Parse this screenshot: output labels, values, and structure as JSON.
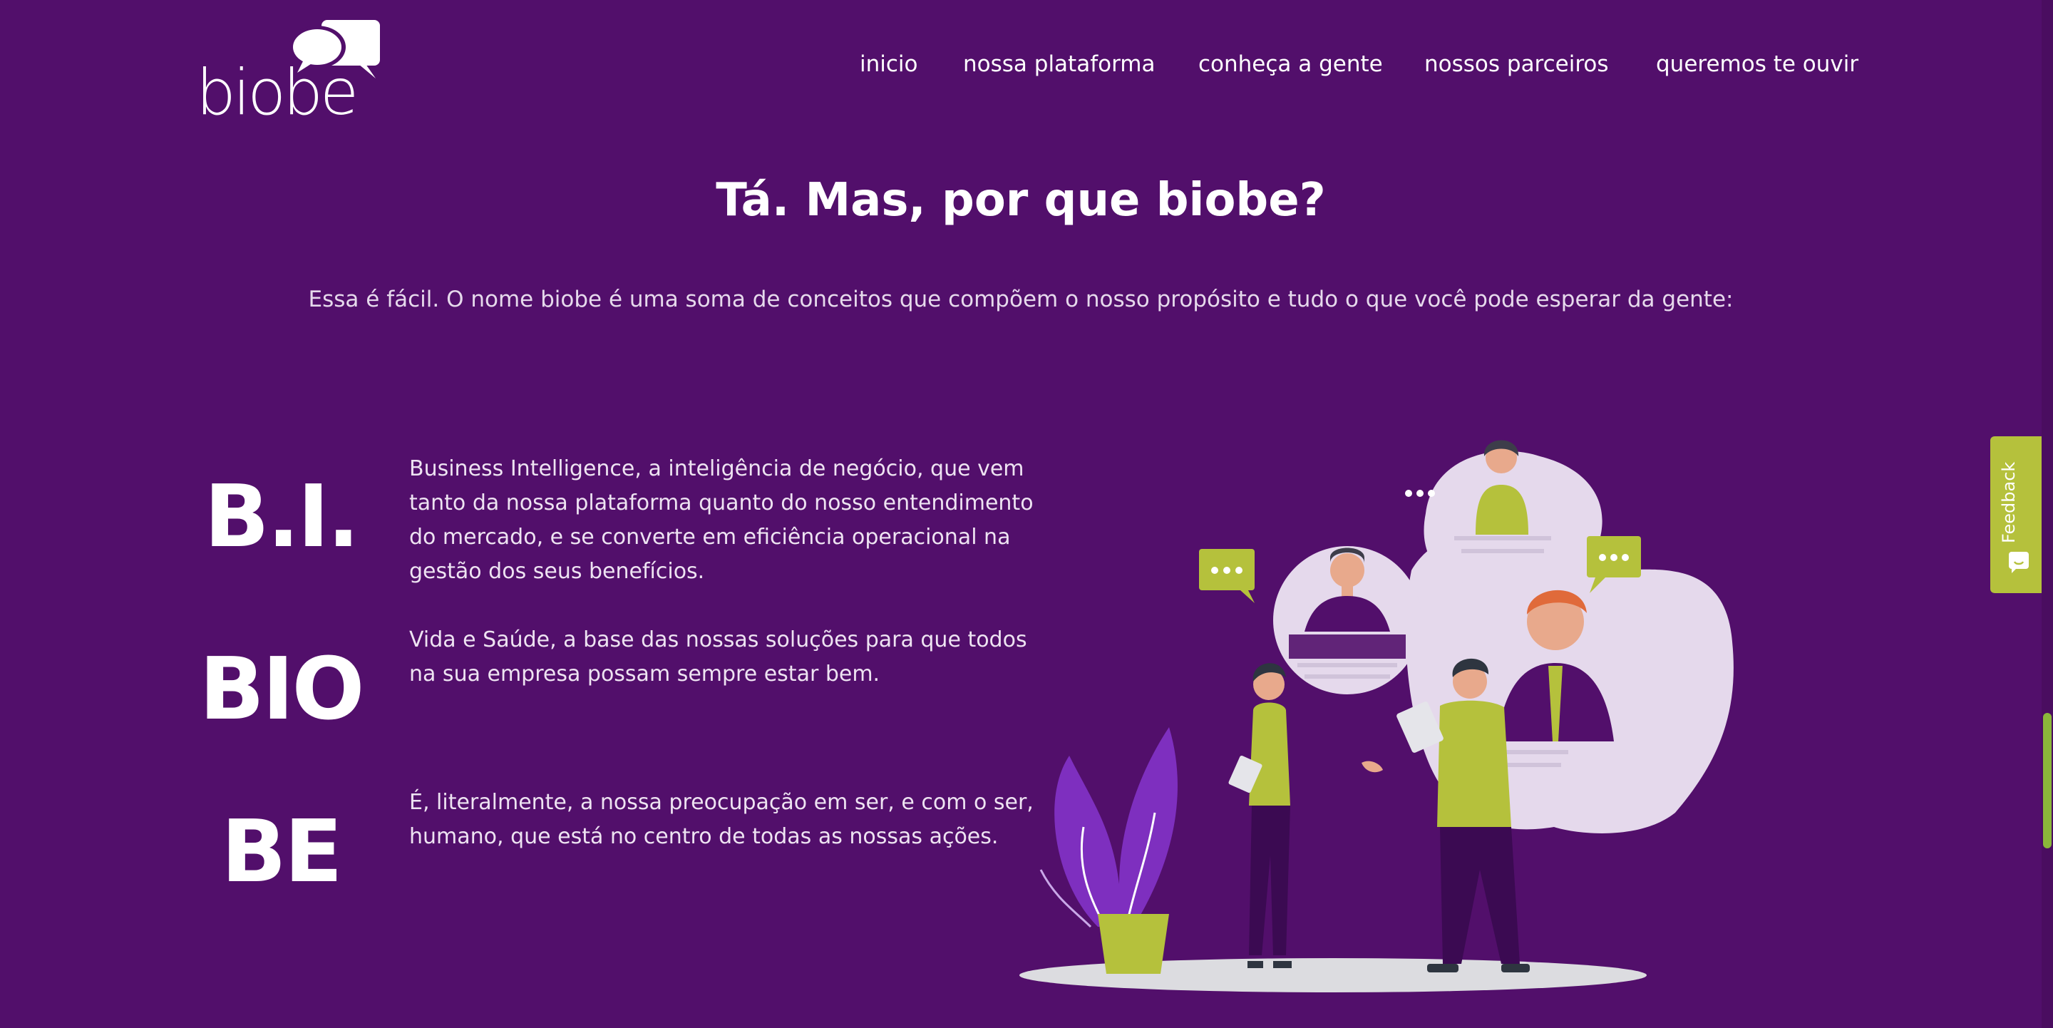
{
  "brand": {
    "logo_text": "biobe"
  },
  "nav": {
    "items": [
      {
        "label": "inicio"
      },
      {
        "label": "nossa plataforma"
      },
      {
        "label": "conheça a gente"
      },
      {
        "label": "nossos parceiros"
      },
      {
        "label": "queremos te ouvir"
      }
    ]
  },
  "section": {
    "title": "Tá. Mas, por que biobe?",
    "subtitle": "Essa é fácil. O nome biobe é uma soma de conceitos que compõem o nosso propósito e tudo o que você pode esperar da gente:"
  },
  "concepts": [
    {
      "label": "B.I.",
      "description": "Business Intelligence, a inteligência de negócio, que vem tanto da nossa plataforma quanto do nosso entendimento do mercado, e se converte em eficiência operacional na gestão dos seus benefícios."
    },
    {
      "label": "BIO",
      "description": "Vida e Saúde, a base das nossas soluções para que todos na sua empresa possam sempre estar bem."
    },
    {
      "label": "BE",
      "description": "É, literalmente, a nossa preocupação em ser, e com o ser, humano, que está no centro de todas as nossas ações."
    }
  ],
  "feedback": {
    "label": "Feedback",
    "icon": "chat-smile-icon"
  },
  "colors": {
    "background": "#520f6b",
    "accent": "#b5c13c",
    "light_purple": "#e6d9ec"
  }
}
